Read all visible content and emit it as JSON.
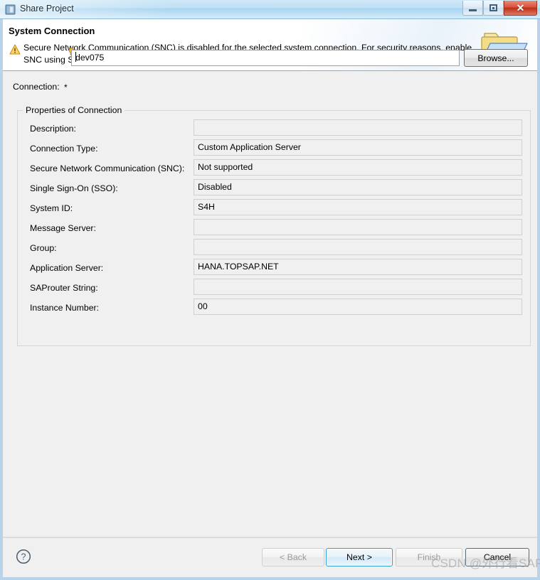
{
  "window": {
    "title": "Share Project",
    "app_icon": "window-app-icon",
    "ghost_title_text": "",
    "controls": {
      "minimize": "minimize-icon",
      "maximize": "restore-icon",
      "close": "✕"
    }
  },
  "banner": {
    "title": "System Connection",
    "warning_icon": "warning-triangle-icon",
    "message": "Secure Network Communication (SNC) is disabled for the selected system connection. For security reasons, enable SNC using SAP Logon.",
    "decoration_icon": "open-folder-icon"
  },
  "connection": {
    "label": "Connection:",
    "required_marker": "*",
    "hint_icon": "lightbulb-hint-icon",
    "value": "dev075",
    "placeholder": "",
    "browse_label": "Browse..."
  },
  "properties": {
    "legend": "Properties of Connection",
    "rows": [
      {
        "label": "Description:",
        "value": ""
      },
      {
        "label": "Connection Type:",
        "value": "Custom Application Server"
      },
      {
        "label": "Secure Network Communication (SNC):",
        "value": "Not supported"
      },
      {
        "label": "Single Sign-On (SSO):",
        "value": "Disabled"
      },
      {
        "label": "System ID:",
        "value": "S4H"
      },
      {
        "label": "Message Server:",
        "value": ""
      },
      {
        "label": "Group:",
        "value": ""
      },
      {
        "label": "Application Server:",
        "value": "HANA.TOPSAP.NET"
      },
      {
        "label": "SAProuter String:",
        "value": ""
      },
      {
        "label": "Instance Number:",
        "value": "00"
      }
    ]
  },
  "footer": {
    "help_icon": "help-circle-icon",
    "back_label": "< Back",
    "next_label": "Next >",
    "finish_label": "Finish",
    "cancel_label": "Cancel"
  },
  "watermark": {
    "text": "CSDN @外行看SAP"
  },
  "colors": {
    "titlebar_blue": "#a8d4f0",
    "close_red": "#bc2f18",
    "focus_blue": "#2f9fd8",
    "warning_amber": "#e8a317",
    "dialog_bg": "#f0f0f0"
  }
}
